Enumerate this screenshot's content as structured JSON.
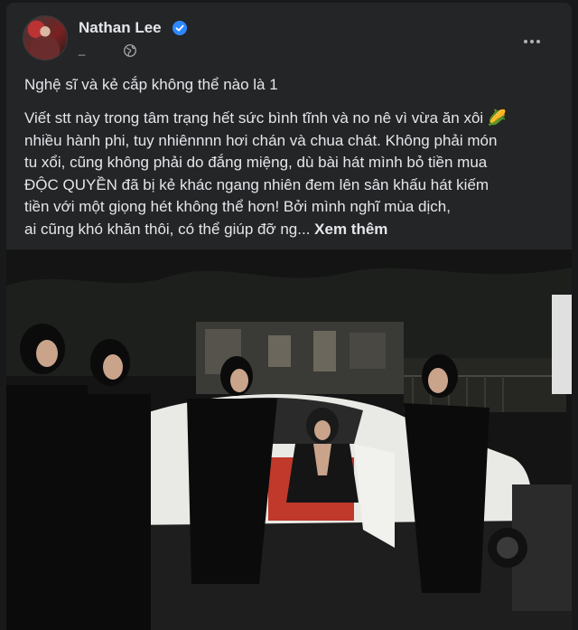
{
  "post": {
    "author_name": "Nathan Lee",
    "meta_text": "_",
    "headline": "Nghệ sĩ và kẻ cắp không thể nào là 1",
    "body_lines": [
      "Viết stt này trong tâm trạng hết sức bình tĩnh và no nê vì vừa ăn xôi 🌽",
      "nhiều hành phi, tuy nhiênnnn hơi chán và chua chát. Không phải món",
      "tu xổi, cũng không phải do đắng miệng, dù bài hát mình bỏ tiền mua",
      "ĐỘC QUYỀN đã bị kẻ khác ngang nhiên đem lên sân khấu hát kiếm",
      "tiền với một giọng hét không thể            hơn! Bởi mình nghĩ mùa dịch,",
      "ai cũng khó khăn thôi, có thể giúp đỡ ng..."
    ],
    "see_more_label": "Xem thêm"
  },
  "icons": {
    "verified": "verified-badge-icon",
    "audience": "globe-icon",
    "more": "more-options-icon"
  },
  "colors": {
    "page_bg": "#18191a",
    "card_bg": "#242526",
    "text_primary": "#e4e6eb",
    "text_secondary": "#b0b3b8",
    "verified_blue": "#2d88ff"
  }
}
